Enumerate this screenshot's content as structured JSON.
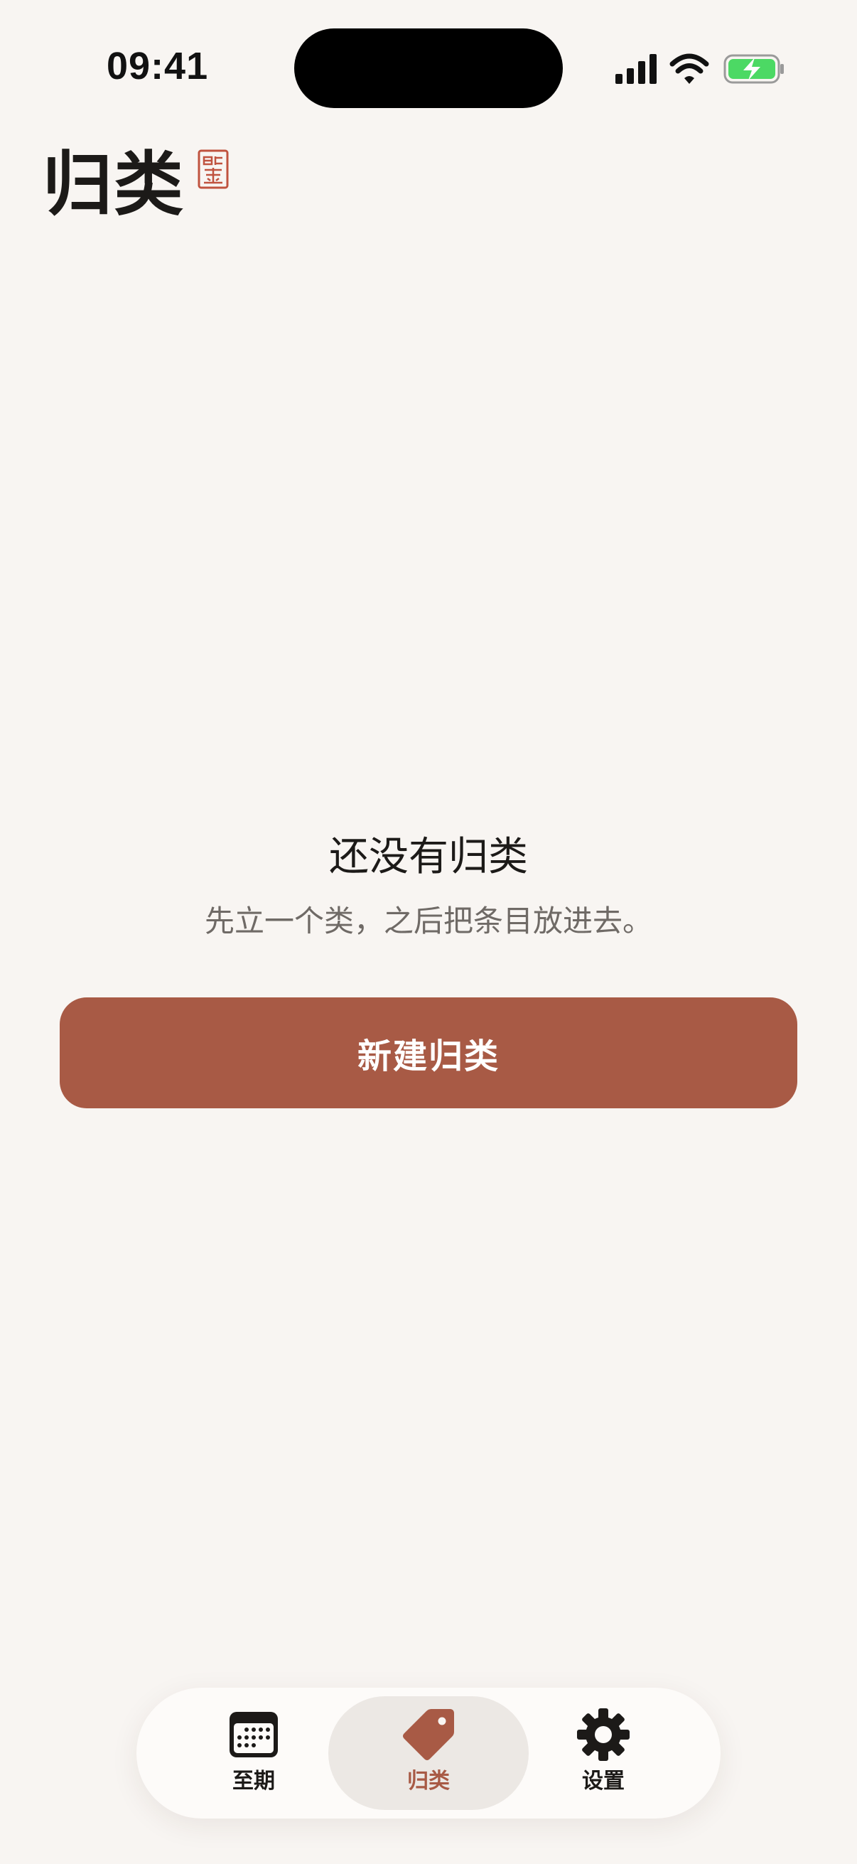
{
  "status_bar": {
    "time": "09:41"
  },
  "header": {
    "title": "归类",
    "seal_icon": "seal-stamp-icon"
  },
  "empty_state": {
    "title": "还没有归类",
    "subtitle": "先立一个类，之后把条目放进去。",
    "button_label": "新建归类"
  },
  "tab_bar": {
    "tabs": [
      {
        "label": "至期",
        "icon": "calendar-icon",
        "active": false
      },
      {
        "label": "归类",
        "icon": "tag-icon",
        "active": true
      },
      {
        "label": "设置",
        "icon": "gear-icon",
        "active": false
      }
    ]
  },
  "colors": {
    "background": "#F8F5F2",
    "accent": "#A85A45",
    "text_primary": "#1C1A18",
    "text_secondary": "#6F6A66",
    "battery_green": "#4CD964"
  }
}
